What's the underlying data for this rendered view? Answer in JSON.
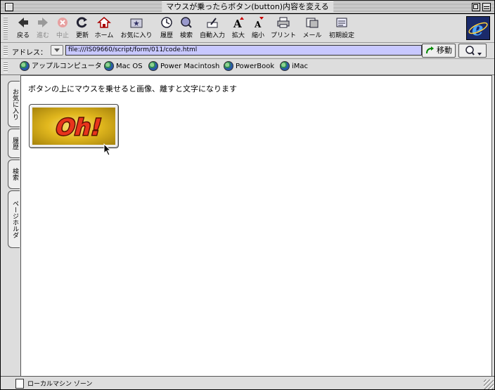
{
  "window": {
    "title": "マウスが乗ったらボタン(button)内容を変える"
  },
  "toolbar": {
    "buttons": [
      {
        "label": "戻る",
        "icon": "back-arrow-icon",
        "enabled": true
      },
      {
        "label": "進む",
        "icon": "forward-arrow-icon",
        "enabled": false
      },
      {
        "label": "中止",
        "icon": "stop-icon",
        "enabled": false
      },
      {
        "label": "更新",
        "icon": "refresh-icon",
        "enabled": true
      },
      {
        "label": "ホーム",
        "icon": "home-icon",
        "enabled": true
      },
      {
        "label": "お気に入り",
        "icon": "favorites-icon",
        "enabled": true
      },
      {
        "label": "履歴",
        "icon": "history-icon",
        "enabled": true
      },
      {
        "label": "検索",
        "icon": "search-icon",
        "enabled": true
      },
      {
        "label": "自動入力",
        "icon": "autofill-icon",
        "enabled": true
      },
      {
        "label": "拡大",
        "icon": "text-larger-icon",
        "enabled": true
      },
      {
        "label": "縮小",
        "icon": "text-smaller-icon",
        "enabled": true
      },
      {
        "label": "プリント",
        "icon": "print-icon",
        "enabled": true
      },
      {
        "label": "メール",
        "icon": "mail-icon",
        "enabled": true
      },
      {
        "label": "初期設定",
        "icon": "preferences-icon",
        "enabled": true
      }
    ]
  },
  "address": {
    "label": "アドレス：",
    "url": "file:///IS09660/script/form/011/code.html",
    "go_label": "移動"
  },
  "favorites_bar": {
    "items": [
      "アップルコンピュータ",
      "Mac OS",
      "Power Macintosh",
      "PowerBook",
      "iMac"
    ]
  },
  "side_tabs": [
    "お気に入り",
    "履歴",
    "検索",
    "ページホルダ"
  ],
  "page": {
    "text": "ボタンの上にマウスを乗せると画像、離すと文字になります",
    "image_text": "Oh!"
  },
  "status": {
    "text": "ローカルマシン ゾーン"
  },
  "colors": {
    "address_field_bg": "#c8c8ff",
    "oh_fill": "#e8341c",
    "oh_stroke": "#5a1200",
    "window_bg": "#dddddd"
  }
}
